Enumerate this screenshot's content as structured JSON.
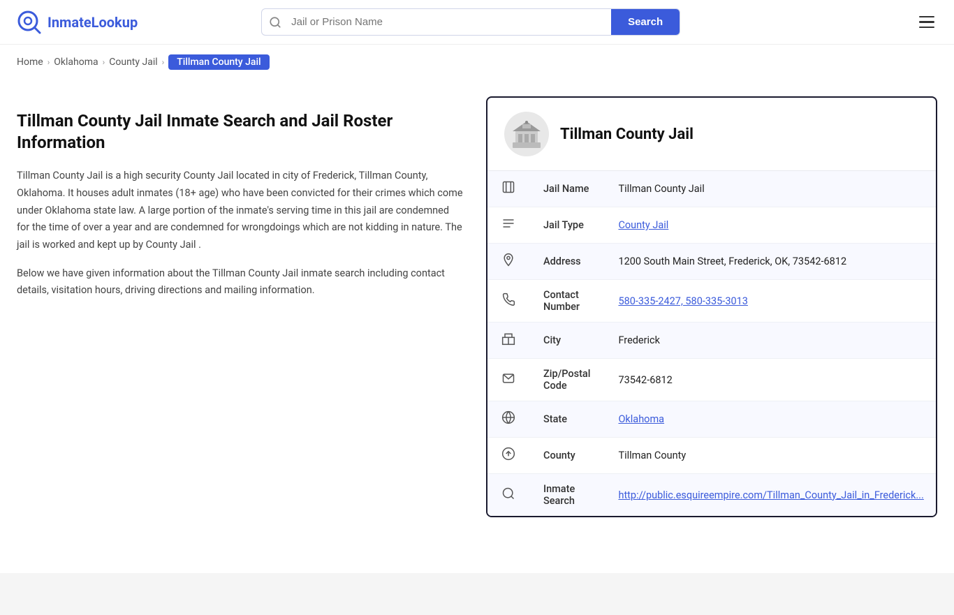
{
  "header": {
    "logo_name": "InmateLookup",
    "logo_highlight": "Inmate",
    "search_placeholder": "Jail or Prison Name",
    "search_button_label": "Search",
    "menu_label": "Menu"
  },
  "breadcrumb": {
    "items": [
      {
        "label": "Home",
        "href": "#",
        "active": false
      },
      {
        "label": "Oklahoma",
        "href": "#",
        "active": false
      },
      {
        "label": "County Jail",
        "href": "#",
        "active": false
      },
      {
        "label": "Tillman County Jail",
        "href": "#",
        "active": true
      }
    ]
  },
  "left": {
    "heading": "Tillman County Jail Inmate Search and Jail Roster Information",
    "paragraph1": "Tillman County Jail is a high security County Jail located in city of Frederick, Tillman County, Oklahoma. It houses adult inmates (18+ age) who have been convicted for their crimes which come under Oklahoma state law. A large portion of the inmate's serving time in this jail are condemned for the time of over a year and are condemned for wrongdoings which are not kidding in nature. The jail is worked and kept up by County Jail .",
    "paragraph2": "Below we have given information about the Tillman County Jail inmate search including contact details, visitation hours, driving directions and mailing information."
  },
  "info_card": {
    "title": "Tillman County Jail",
    "rows": [
      {
        "icon": "jail-icon",
        "label": "Jail Name",
        "value": "Tillman County Jail",
        "link": false
      },
      {
        "icon": "type-icon",
        "label": "Jail Type",
        "value": "County Jail",
        "link": true,
        "href": "#"
      },
      {
        "icon": "address-icon",
        "label": "Address",
        "value": "1200 South Main Street, Frederick, OK, 73542-6812",
        "link": false
      },
      {
        "icon": "phone-icon",
        "label": "Contact Number",
        "value": "580-335-2427, 580-335-3013",
        "link": true,
        "href": "#"
      },
      {
        "icon": "city-icon",
        "label": "City",
        "value": "Frederick",
        "link": false
      },
      {
        "icon": "zip-icon",
        "label": "Zip/Postal Code",
        "value": "73542-6812",
        "link": false
      },
      {
        "icon": "state-icon",
        "label": "State",
        "value": "Oklahoma",
        "link": true,
        "href": "#"
      },
      {
        "icon": "county-icon",
        "label": "County",
        "value": "Tillman County",
        "link": false
      },
      {
        "icon": "search-link-icon",
        "label": "Inmate Search",
        "value": "http://public.esquireempire.com/Tillman_County_Jail_in_Frederick...",
        "link": true,
        "href": "#"
      }
    ]
  }
}
